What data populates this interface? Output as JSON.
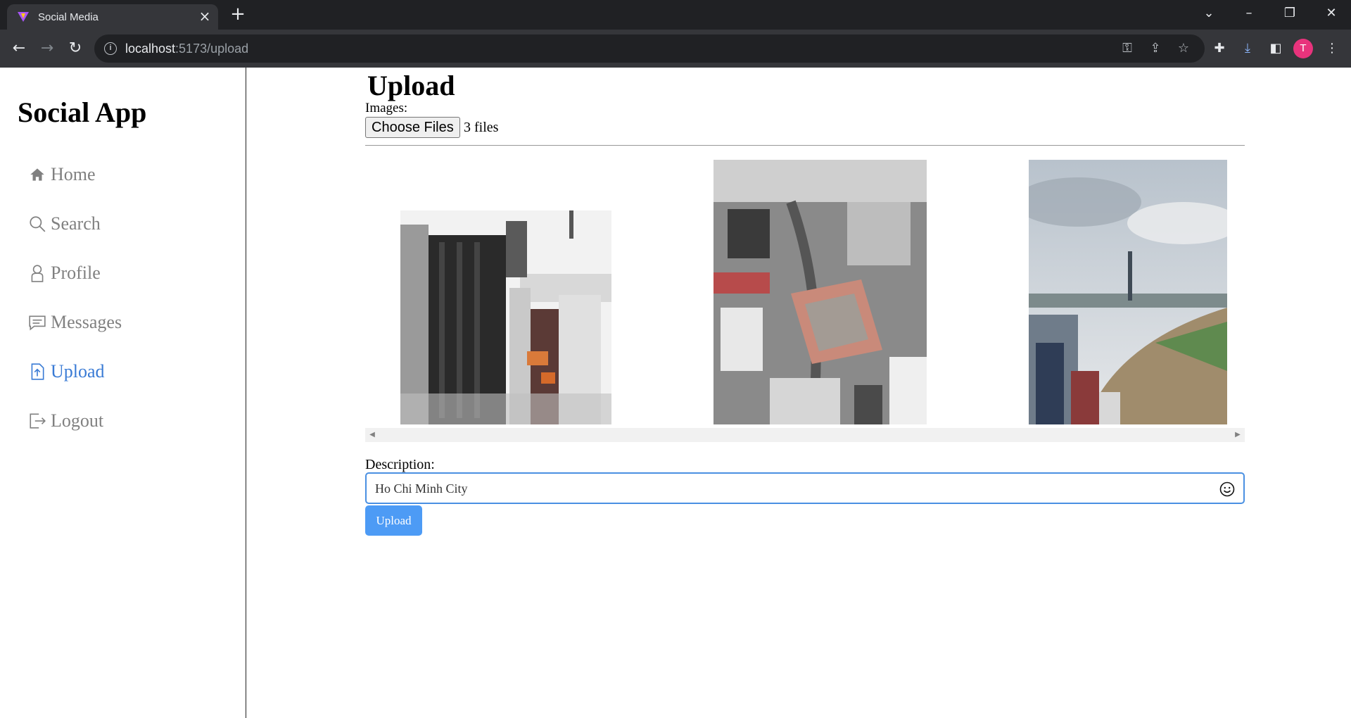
{
  "browser": {
    "tab_title": "Social Media",
    "url_host": "localhost",
    "url_rest": ":5173/upload",
    "profile_initial": "T"
  },
  "sidebar": {
    "brand": "Social App",
    "items": [
      {
        "label": "Home",
        "icon": "home-icon",
        "active": false
      },
      {
        "label": "Search",
        "icon": "search-icon",
        "active": false
      },
      {
        "label": "Profile",
        "icon": "profile-icon",
        "active": false
      },
      {
        "label": "Messages",
        "icon": "messages-icon",
        "active": false
      },
      {
        "label": "Upload",
        "icon": "upload-icon",
        "active": true
      },
      {
        "label": "Logout",
        "icon": "logout-icon",
        "active": false
      }
    ]
  },
  "upload": {
    "title": "Upload",
    "images_label": "Images:",
    "choose_button": "Choose Files",
    "file_count": "3 files",
    "description_label": "Description:",
    "description_value": "Ho Chi Minh City",
    "submit_button": "Upload"
  },
  "colors": {
    "accent": "#3a7bd5",
    "button": "#4d9bf5",
    "browser_dark": "#202124"
  }
}
